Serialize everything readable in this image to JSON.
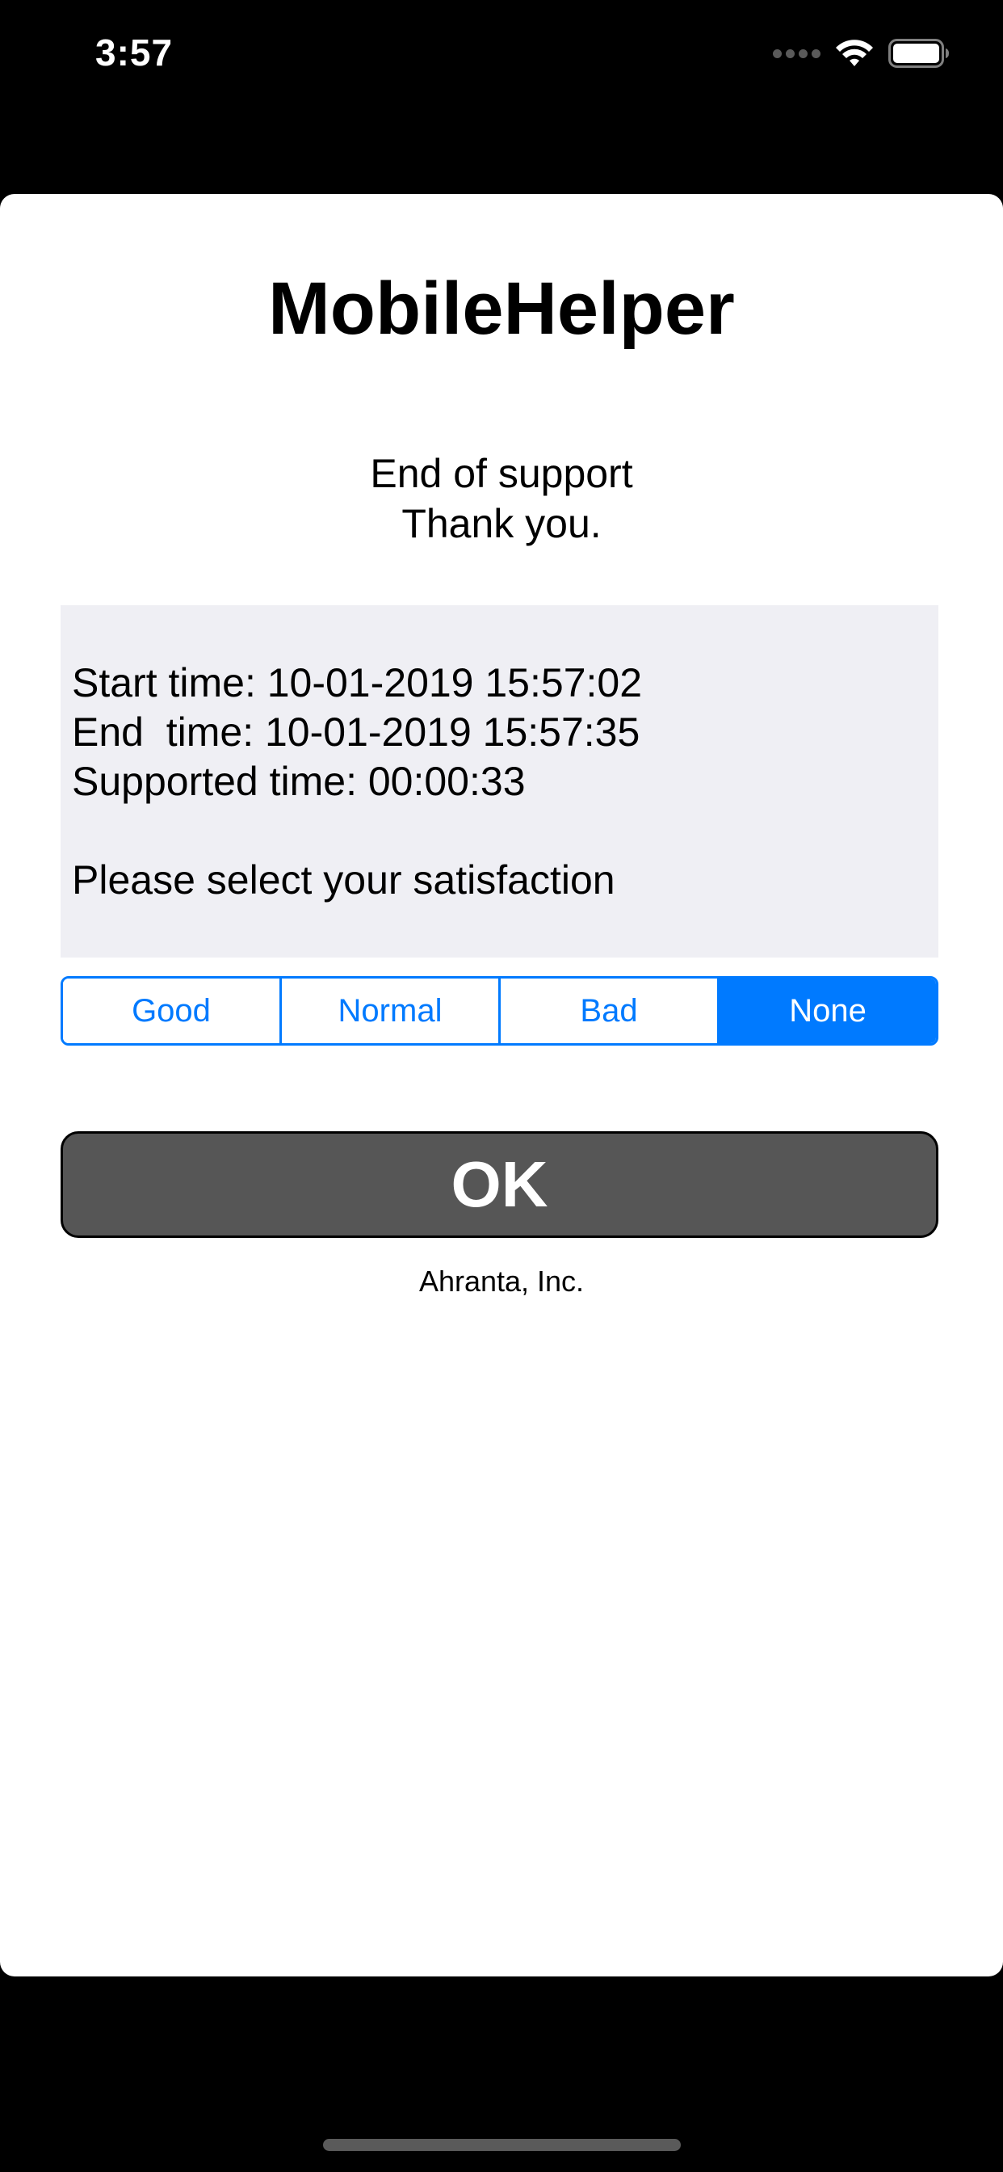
{
  "status_bar": {
    "time": "3:57",
    "icons": [
      "cellular-signal-icon",
      "wifi-icon",
      "battery-icon"
    ]
  },
  "app": {
    "title": "MobileHelper",
    "message_line1": "End of support",
    "message_line2": "Thank you."
  },
  "info": {
    "start_time": "Start time: 10-01-2019 15:57:02",
    "end_time": "End  time: 10-01-2019 15:57:35",
    "supported_time": "Supported time: 00:00:33",
    "prompt": "Please select your satisfaction"
  },
  "satisfaction": {
    "options": [
      "Good",
      "Normal",
      "Bad",
      "None"
    ],
    "selected": "None"
  },
  "ok_label": "OK",
  "company": "Ahranta, Inc.",
  "colors": {
    "accent": "#007aff",
    "button_bg": "#565656",
    "info_bg": "#efeff4"
  }
}
